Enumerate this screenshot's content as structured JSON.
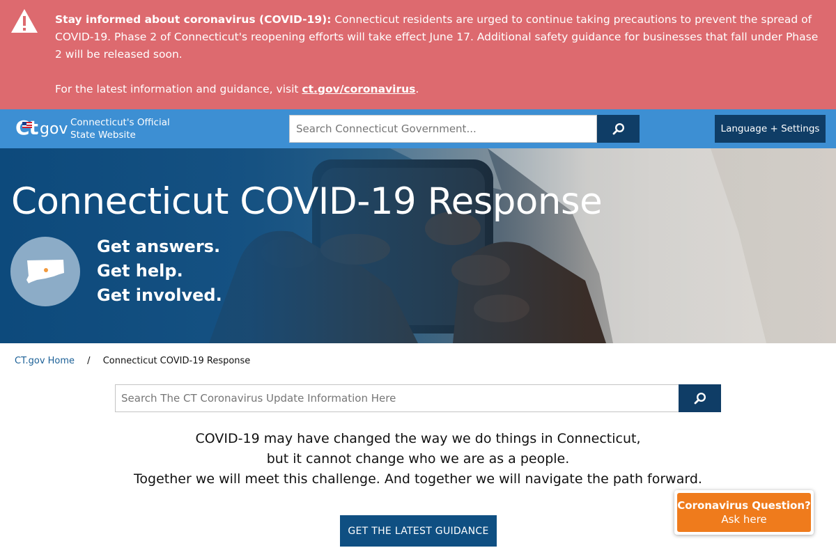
{
  "alert": {
    "heading": "Stay informed about coronavirus (COVID-19):",
    "message": "Connecticut residents are urged to continue taking precautions to prevent the spread of COVID-19. Phase 2 of Connecticut's reopening efforts will take effect June 17. Additional safety guidance for businesses that fall under Phase 2 will be released soon.",
    "info_prefix": "For the latest information and guidance, visit",
    "link_text": "ct.gov/coronavirus",
    "info_suffix": ".",
    "icon": "warning-icon"
  },
  "header": {
    "logo_ct": "Ct",
    "logo_gov": ".gov",
    "site_tagline_line1": "Connecticut's Official",
    "site_tagline_line2": "State Website",
    "search_placeholder": "Search Connecticut Government...",
    "search_icon": "search-icon",
    "language_button": "Language + Settings"
  },
  "hero": {
    "title": "Connecticut COVID-19 Response",
    "lines": [
      "Get answers.",
      "Get help.",
      "Get involved."
    ],
    "emblem_icon": "connecticut-map-icon"
  },
  "breadcrumb": {
    "home": "CT.gov Home",
    "separator": "/",
    "current": "Connecticut COVID-19 Response"
  },
  "main_search": {
    "placeholder": "Search The CT Coronavirus Update Information Here",
    "icon": "search-icon"
  },
  "tagline": [
    "COVID-19 may have changed the way we do things in Connecticut,",
    "but it cannot change who we are as a people.",
    "Together we will meet this challenge. And together we will navigate the path forward."
  ],
  "cta": {
    "label": "GET THE LATEST GUIDANCE"
  },
  "chat": {
    "title": "Coronavirus Question?",
    "subtitle": "Ask here"
  },
  "colors": {
    "alert_bg": "#dd6a6f",
    "header_bg": "#3d8fd3",
    "navy": "#0f3d66",
    "cta_bg": "#0f4f82",
    "chat_orange": "#ef7b1c"
  }
}
